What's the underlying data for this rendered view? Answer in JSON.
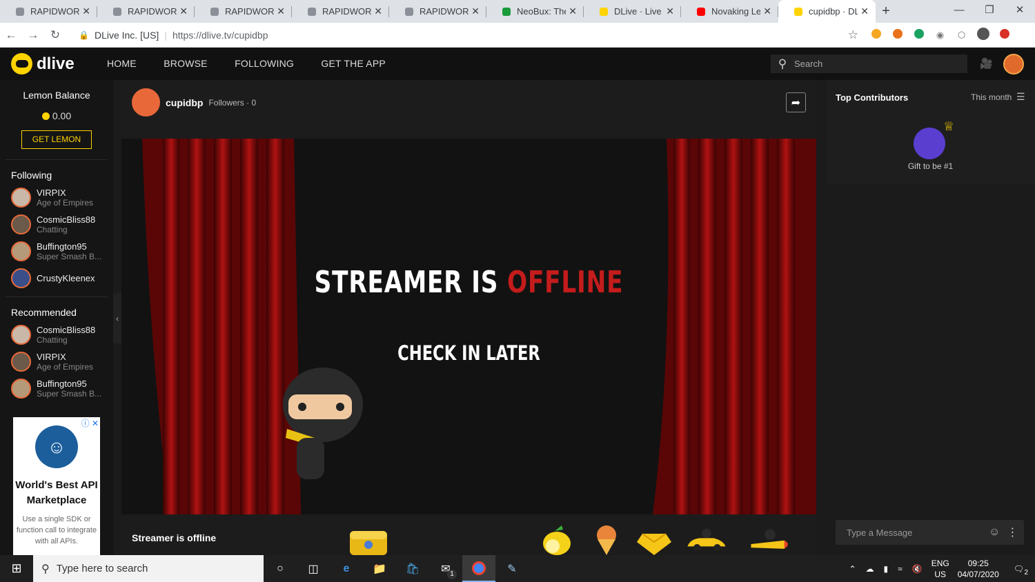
{
  "browser": {
    "tabs": [
      {
        "title": "RAPIDWORKER",
        "icon": "rapidworker-icon",
        "active": false
      },
      {
        "title": "RAPIDWORKER",
        "icon": "rapidworker-icon",
        "active": false
      },
      {
        "title": "RAPIDWORKER",
        "icon": "rapidworker-icon",
        "active": false
      },
      {
        "title": "RAPIDWORKER",
        "icon": "rapidworker-icon",
        "active": false
      },
      {
        "title": "RAPIDWORKER",
        "icon": "rapidworker-icon",
        "active": false
      },
      {
        "title": "NeoBux: The In",
        "icon": "neobux-icon",
        "active": false
      },
      {
        "title": "DLive · Live",
        "icon": "dlive-icon",
        "active": false
      },
      {
        "title": "Novaking Leak",
        "icon": "youtube-icon",
        "active": false
      },
      {
        "title": "cupidbp · DLive",
        "icon": "dlive-icon",
        "active": true
      }
    ],
    "new_tab": "+",
    "site_identity": "DLive Inc. [US]",
    "url": "https://dlive.tv/cupidbp"
  },
  "site": {
    "logo_text": "dlive",
    "nav": [
      "HOME",
      "BROWSE",
      "FOLLOWING",
      "GET THE APP"
    ],
    "search_placeholder": "Search",
    "brand_color": "#ffd300",
    "offline_red": "#c41c1c"
  },
  "sidebar": {
    "lemon_title": "Lemon Balance",
    "lemon_value": "0.00",
    "get_lemon": "GET LEMON",
    "following_title": "Following",
    "following": [
      {
        "name": "VIRPIX",
        "sub": "Age of Empires"
      },
      {
        "name": "CosmicBliss88",
        "sub": "Chatting"
      },
      {
        "name": "Buffington95",
        "sub": "Super Smash B..."
      },
      {
        "name": "CrustyKleenex",
        "sub": ""
      }
    ],
    "recommended_title": "Recommended",
    "recommended": [
      {
        "name": "CosmicBliss88",
        "sub": "Chatting"
      },
      {
        "name": "VIRPIX",
        "sub": "Age of Empires"
      },
      {
        "name": "Buffington95",
        "sub": "Super Smash B..."
      }
    ],
    "ad": {
      "headline": "World's Best API Marketplace",
      "body": "Use a single SDK or function call to integrate with all APIs."
    }
  },
  "channel": {
    "name": "cupidbp",
    "followers_label": "Followers · 0",
    "offline_word1": "STREAMER IS",
    "offline_word2": "OFFLINE",
    "check_in": "CHECK IN LATER",
    "status": "Streamer is offline"
  },
  "contributors": {
    "title": "Top Contributors",
    "period": "This month",
    "gift_text": "Gift to be #1"
  },
  "chat": {
    "placeholder": "Type a Message"
  },
  "taskbar": {
    "search_placeholder": "Type here to search",
    "mail_badge": "1",
    "lang_top": "ENG",
    "lang_bottom": "US",
    "time": "09:25",
    "date": "04/07/2020",
    "notif_badge": "2"
  }
}
